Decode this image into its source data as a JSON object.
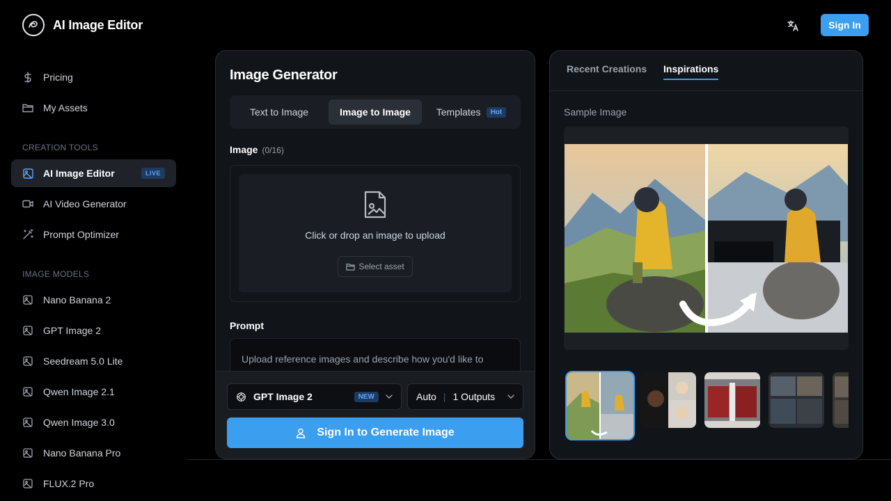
{
  "header": {
    "app_title": "AI Image Editor",
    "signin_label": "Sign In"
  },
  "sidebar": {
    "top_items": [
      {
        "label": "Pricing",
        "icon": "dollar-icon"
      },
      {
        "label": "My Assets",
        "icon": "folder-icon"
      }
    ],
    "creation_tools_label": "CREATION TOOLS",
    "creation_tools": [
      {
        "label": "AI Image Editor",
        "icon": "image-icon",
        "badge": "LIVE",
        "active": true
      },
      {
        "label": "AI Video Generator",
        "icon": "video-icon"
      },
      {
        "label": "Prompt Optimizer",
        "icon": "wand-icon"
      }
    ],
    "image_models_label": "IMAGE MODELS",
    "image_models": [
      {
        "label": "Nano Banana 2"
      },
      {
        "label": "GPT Image 2"
      },
      {
        "label": "Seedream 5.0 Lite"
      },
      {
        "label": "Qwen Image 2.1"
      },
      {
        "label": "Qwen Image 3.0"
      },
      {
        "label": "Nano Banana Pro"
      },
      {
        "label": "FLUX.2 Pro"
      }
    ]
  },
  "generator": {
    "title": "Image Generator",
    "tabs": [
      {
        "label": "Text to Image"
      },
      {
        "label": "Image to Image",
        "active": true
      },
      {
        "label": "Templates",
        "badge": "Hot"
      }
    ],
    "image_label": "Image",
    "image_count": "(0/16)",
    "upload_text": "Click or drop an image to upload",
    "select_asset": "Select asset",
    "prompt_label": "Prompt",
    "prompt_placeholder": "Upload reference images and describe how you'd like to",
    "model": {
      "name": "GPT Image 2",
      "badge": "NEW"
    },
    "ratio": "Auto",
    "outputs": "1 Outputs",
    "generate_label": "Sign In to Generate Image"
  },
  "inspirations": {
    "tabs": [
      {
        "label": "Recent Creations"
      },
      {
        "label": "Inspirations",
        "active": true
      }
    ],
    "sample_label": "Sample Image"
  },
  "colors": {
    "accent": "#3b9eef",
    "background": "#000000",
    "panel": "#111418"
  }
}
